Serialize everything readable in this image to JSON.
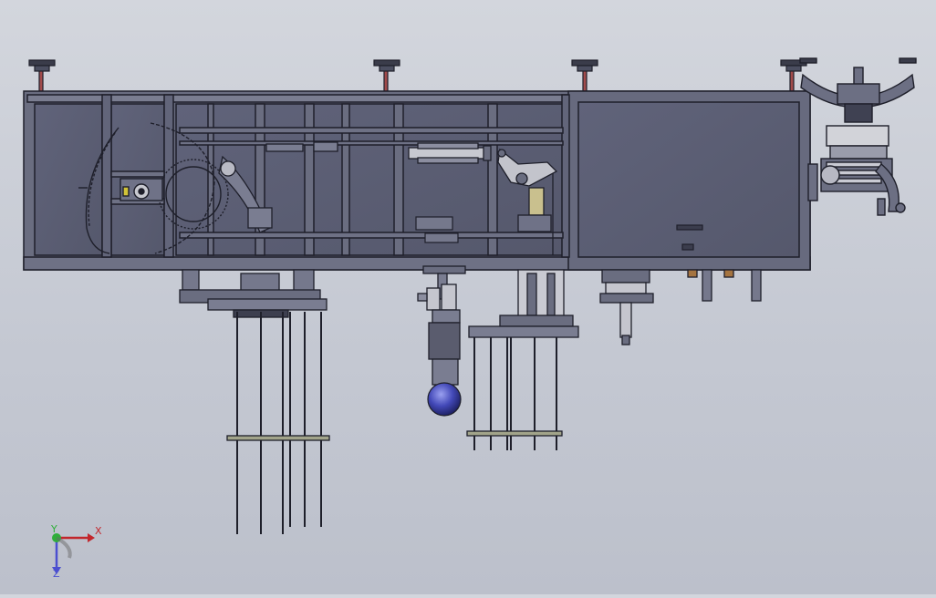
{
  "viewport": {
    "background_top": "#d3d6dd",
    "background_bottom": "#bcc0cb",
    "model_color": "#5a5d70",
    "edge_color": "#1e1f2a",
    "accent_blue": "#4b4fd0",
    "accent_red": "#c2262c",
    "accent_green": "#2fae3a"
  },
  "triad": {
    "x_label": "X",
    "y_label": "Y",
    "z_label": "Z"
  },
  "parts": {
    "icons": [
      "leveling-foot-icon",
      "chain-sprocket-icon",
      "ball-caster-icon",
      "triad-icon"
    ]
  }
}
